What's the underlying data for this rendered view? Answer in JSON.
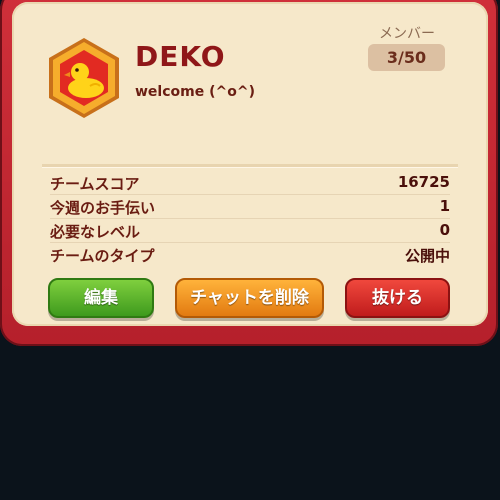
{
  "team": {
    "name": "DEKO",
    "description": "welcome (^o^)",
    "badge_icon": "duck-icon"
  },
  "members": {
    "label": "メンバー",
    "count": "3/50"
  },
  "stats": [
    {
      "label": "チームスコア",
      "value": "16725"
    },
    {
      "label": "今週のお手伝い",
      "value": "1"
    },
    {
      "label": "必要なレベル",
      "value": "0"
    },
    {
      "label": "チームのタイプ",
      "value": "公開中"
    }
  ],
  "buttons": {
    "edit": "編集",
    "delete_chat": "チャットを削除",
    "leave": "抜ける"
  },
  "colors": {
    "frame": "#c82530",
    "panel": "#f6e8ca",
    "edit_button": "#5cb82c",
    "delete_button": "#f0961f",
    "leave_button": "#d92b2b",
    "badge": "#f5a81c"
  }
}
